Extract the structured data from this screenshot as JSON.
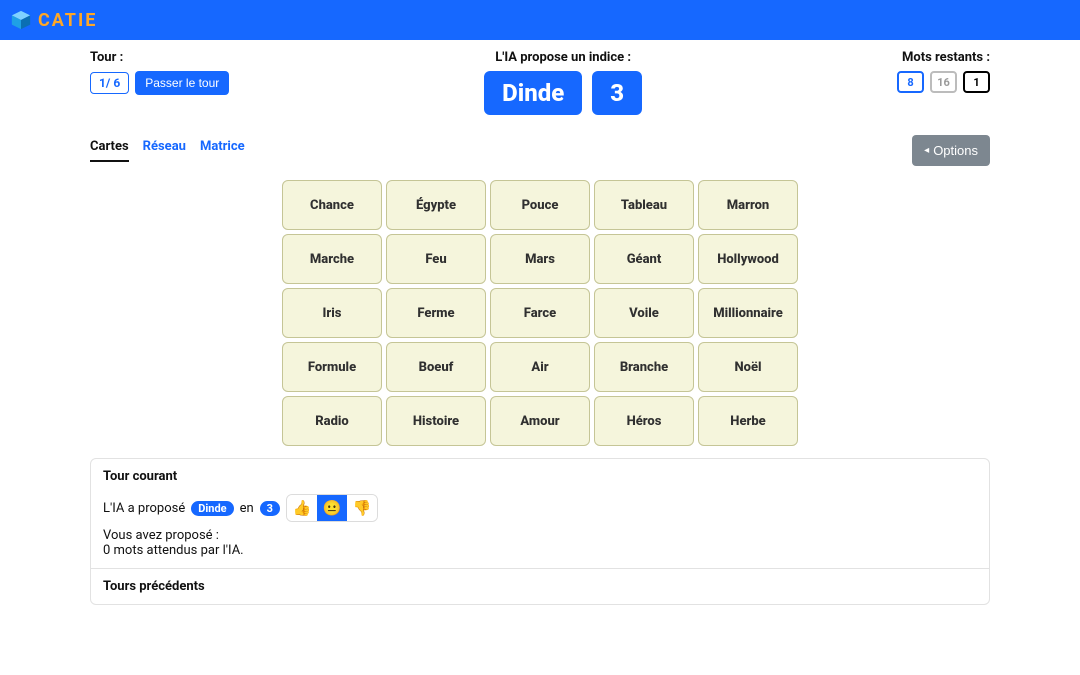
{
  "brand": "CATIE",
  "status": {
    "turn_label": "Tour :",
    "turn_value": "1/ 6",
    "skip_label": "Passer le tour",
    "clue_header": "L'IA propose un indice :",
    "clue_word": "Dinde",
    "clue_count": "3",
    "remaining_label": "Mots restants :",
    "counts": {
      "blue": "8",
      "muted": "16",
      "black": "1"
    }
  },
  "tabs": {
    "t0": "Cartes",
    "t1": "Réseau",
    "t2": "Matrice"
  },
  "options_label": "Options",
  "cards": {
    "c0": "Chance",
    "c1": "Égypte",
    "c2": "Pouce",
    "c3": "Tableau",
    "c4": "Marron",
    "c5": "Marche",
    "c6": "Feu",
    "c7": "Mars",
    "c8": "Géant",
    "c9": "Hollywood",
    "c10": "Iris",
    "c11": "Ferme",
    "c12": "Farce",
    "c13": "Voile",
    "c14": "Millionnaire",
    "c15": "Formule",
    "c16": "Boeuf",
    "c17": "Air",
    "c18": "Branche",
    "c19": "Noël",
    "c20": "Radio",
    "c21": "Histoire",
    "c22": "Amour",
    "c23": "Héros",
    "c24": "Herbe"
  },
  "panel": {
    "current_title": "Tour courant",
    "proposed_prefix": "L'IA a proposé",
    "proposed_joiner": "en",
    "chip_word": "Dinde",
    "chip_count": "3",
    "react_up": "👍",
    "react_mid": "😐",
    "react_down": "👎",
    "you_proposed": "Vous avez proposé :",
    "expected": "0 mots attendus par l'IA.",
    "previous_title": "Tours précédents"
  }
}
